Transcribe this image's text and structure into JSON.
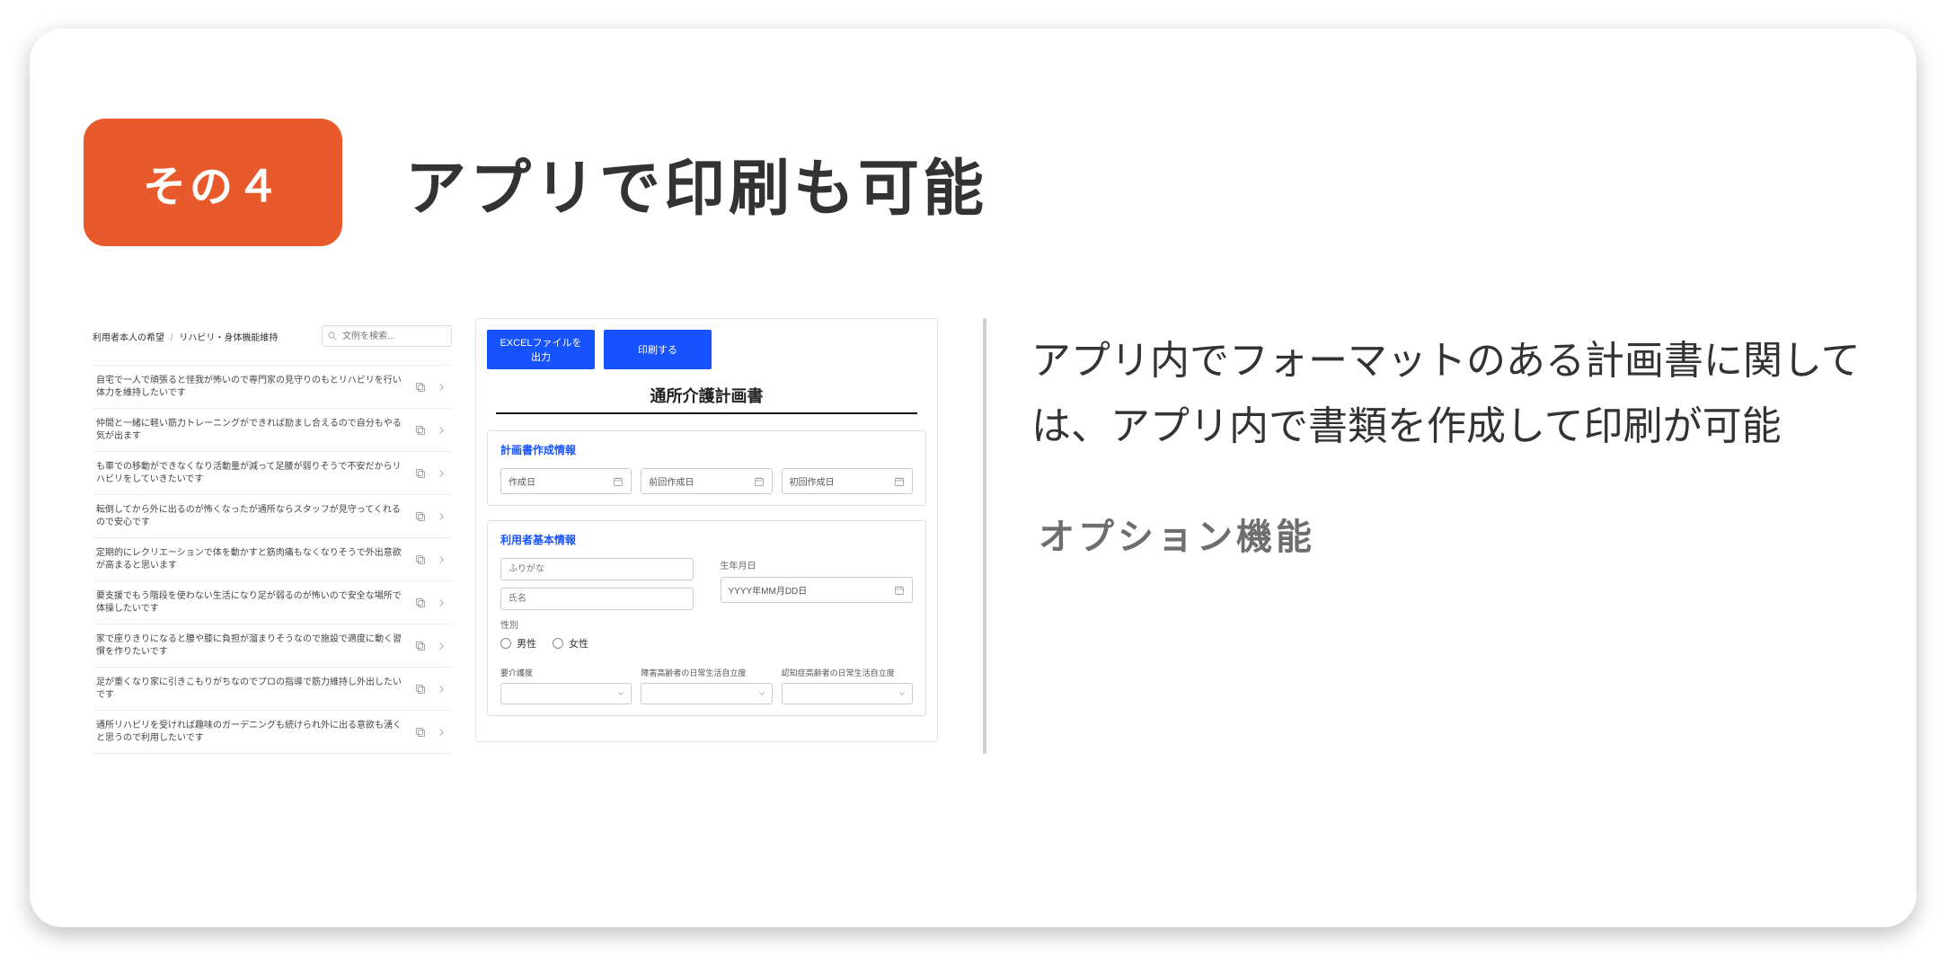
{
  "badge": "その４",
  "title": "アプリで印刷も可能",
  "description": "アプリ内でフォーマットのある計画書に関しては、アプリ内で書類を作成して印刷が可能",
  "subtag": "オプション機能",
  "leftPanel": {
    "breadcrumb": {
      "a": "利用者本人の希望",
      "sep": "/",
      "b": "リハビリ・身体機能維持"
    },
    "search": {
      "placeholder": "文例を検索..."
    },
    "items": [
      "自宅で一人で頑張ると怪我が怖いので専門家の見守りのもとリハビリを行い体力を維持したいです",
      "仲間と一緒に軽い筋力トレーニングができれば励まし合えるので自分もやる気が出ます",
      "も車での移動ができなくなり活動量が減って足腰が弱りそうで不安だからリハビリをしていきたいです",
      "転倒してから外に出るのが怖くなったが通所ならスタッフが見守ってくれるので安心です",
      "定期的にレクリエーションで体を動かすと筋肉痛もなくなりそうで外出意欲が高まると思います",
      "要支援でもう階段を使わない生活になり足が弱るのが怖いので安全な場所で体操したいです",
      "家で座りきりになると腰や膝に負担が溜まりそうなので施設で適度に動く習慣を作りたいです",
      "足が重くなり家に引きこもりがちなのでプロの指導で筋力維持し外出したいです",
      "通所リハビリを受ければ趣味のガーデニングも続けられ外に出る意欲も湧くと思うので利用したいです"
    ]
  },
  "rightPanel": {
    "buttons": {
      "excel": "EXCELファイルを出力",
      "print": "印刷する"
    },
    "title": "通所介護計画書",
    "section1": {
      "title": "計画書作成情報",
      "dates": [
        "作成日",
        "前回作成日",
        "初回作成日"
      ]
    },
    "section2": {
      "title": "利用者基本情報",
      "furigana_ph": "ふりがな",
      "name_ph": "氏名",
      "birth_label": "生年月日",
      "birth_ph": "YYYY年MM月DD日",
      "gender_label": "性別",
      "gender_options": [
        "男性",
        "女性"
      ],
      "selects": [
        "要介護度",
        "障害高齢者の日常生活自立度",
        "認知症高齢者の日常生活自立度"
      ]
    }
  }
}
